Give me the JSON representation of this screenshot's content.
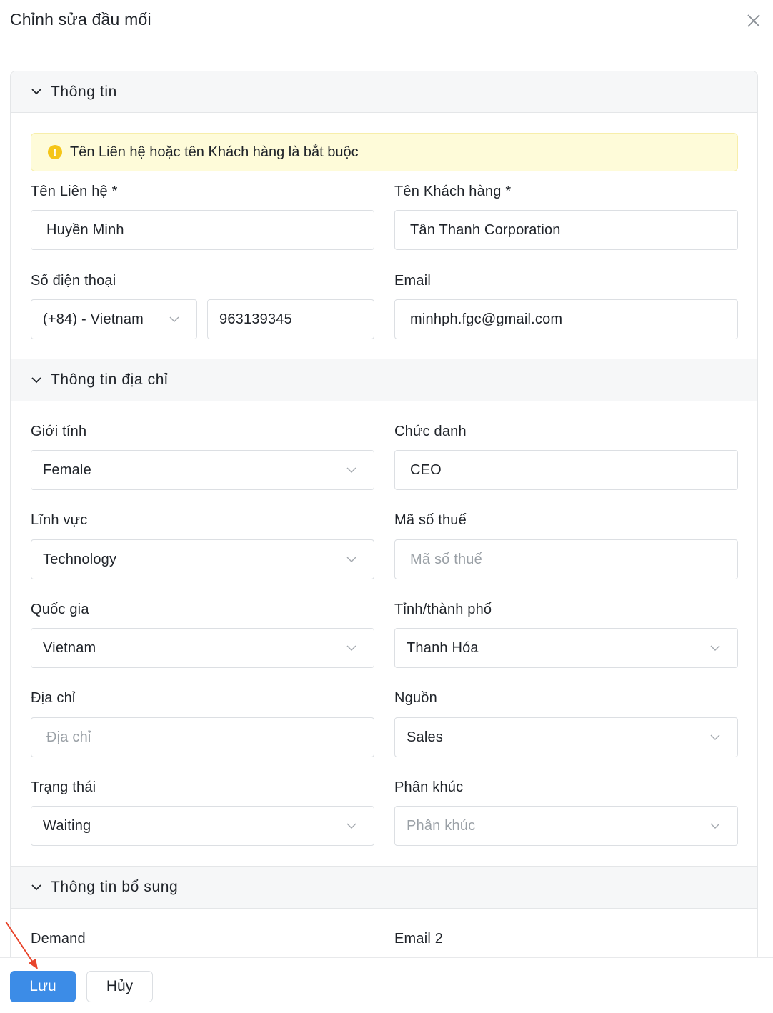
{
  "header": {
    "title": "Chỉnh sửa đầu mối",
    "close_icon": "close-icon"
  },
  "sections": {
    "info": {
      "title": "Thông tin"
    },
    "address": {
      "title": "Thông tin địa chỉ"
    },
    "extra": {
      "title": "Thông tin bổ sung"
    }
  },
  "alert": {
    "text": "Tên Liên hệ hoặc tên Khách hàng là bắt buộc",
    "icon": "warning-icon",
    "color": "#f5c518"
  },
  "fields": {
    "contact_name": {
      "label": "Tên Liên hệ *",
      "value": "Huyền Minh"
    },
    "customer_name": {
      "label": "Tên Khách hàng *",
      "value": "Tân Thanh Corporation"
    },
    "phone": {
      "label": "Số điện thoại",
      "country_code": "(+84) - Vietnam",
      "number": "963139345"
    },
    "email": {
      "label": "Email",
      "value": "minhph.fgc@gmail.com"
    },
    "gender": {
      "label": "Giới tính",
      "value": "Female"
    },
    "job_title": {
      "label": "Chức danh",
      "value": "CEO"
    },
    "industry": {
      "label": "Lĩnh vực",
      "value": "Technology"
    },
    "tax_code": {
      "label": "Mã số thuế",
      "placeholder": "Mã số thuế"
    },
    "country": {
      "label": "Quốc gia",
      "value": "Vietnam"
    },
    "province": {
      "label": "Tỉnh/thành phố",
      "value": "Thanh Hóa"
    },
    "address": {
      "label": "Địa chỉ",
      "placeholder": "Địa chỉ"
    },
    "source": {
      "label": "Nguồn",
      "value": "Sales"
    },
    "status": {
      "label": "Trạng thái",
      "value": "Waiting"
    },
    "segment": {
      "label": "Phân khúc",
      "placeholder": "Phân khúc"
    },
    "demand": {
      "label": "Demand"
    },
    "email2": {
      "label": "Email 2"
    }
  },
  "footer": {
    "save_label": "Lưu",
    "cancel_label": "Hủy"
  },
  "colors": {
    "primary": "#3c8ce7",
    "annotation_arrow": "#e8452c"
  }
}
